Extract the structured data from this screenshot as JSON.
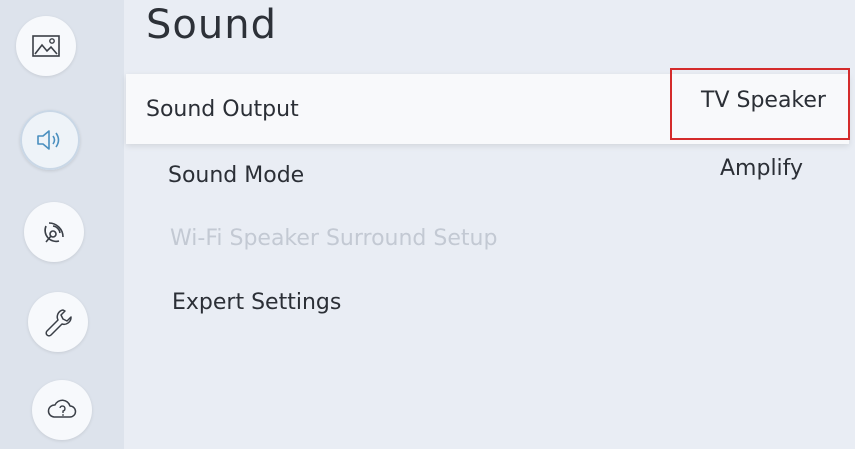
{
  "page": {
    "title": "Sound"
  },
  "sidebar": {
    "items": [
      {
        "icon": "picture-icon"
      },
      {
        "icon": "sound-icon",
        "active": true
      },
      {
        "icon": "broadcast-icon"
      },
      {
        "icon": "wrench-icon"
      },
      {
        "icon": "cloud-help-icon"
      }
    ]
  },
  "menu": {
    "items": [
      {
        "label": "Sound Output",
        "value": "TV Speaker",
        "focused": true
      },
      {
        "label": "Sound Mode",
        "value": "Amplify"
      },
      {
        "label": "Wi-Fi Speaker Surround Setup",
        "disabled": true
      },
      {
        "label": "Expert Settings"
      }
    ]
  },
  "colors": {
    "highlight_border": "#d42b2b"
  }
}
